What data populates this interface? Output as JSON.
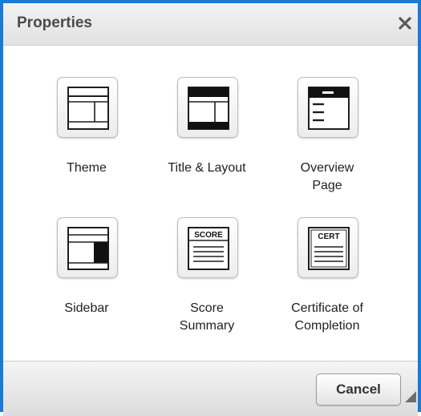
{
  "dialog": {
    "title": "Properties",
    "close_icon": "close-icon"
  },
  "items": [
    {
      "label_lines": [
        "Theme"
      ],
      "icon": "theme-icon"
    },
    {
      "label_lines": [
        "Title & Layout"
      ],
      "icon": "title-layout-icon"
    },
    {
      "label_lines": [
        "Overview",
        "Page"
      ],
      "icon": "overview-page-icon"
    },
    {
      "label_lines": [
        "Sidebar"
      ],
      "icon": "sidebar-icon"
    },
    {
      "label_lines": [
        "Score",
        "Summary"
      ],
      "icon": "score-summary-icon",
      "icon_text": "SCORE"
    },
    {
      "label_lines": [
        "Certificate of",
        "Completion"
      ],
      "icon": "certificate-icon",
      "icon_text": "CERT"
    }
  ],
  "footer": {
    "cancel_label": "Cancel",
    "resize_icon": "resize-grip-icon"
  },
  "colors": {
    "accent_border": "#1a7bd4",
    "title_text": "#4b4b4b",
    "label_text": "#222222"
  }
}
